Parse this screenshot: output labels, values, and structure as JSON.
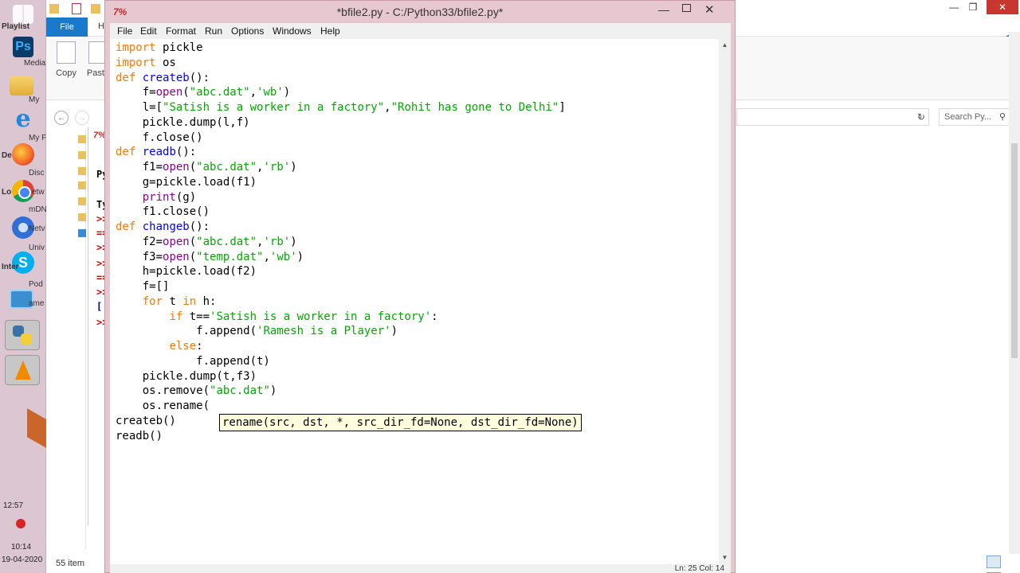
{
  "desktop": {
    "labels": [
      "Playlist",
      "Media",
      "My",
      "My F",
      "De",
      "Disc",
      "Lo",
      "etw",
      "mDN",
      "Netv",
      "Univ",
      "Inter",
      "Pod",
      "ame"
    ],
    "clock_a": "12:57",
    "clock_b": "10:14",
    "date": "19-04-2020"
  },
  "explorer": {
    "file_tab": "File",
    "home_tab": "H",
    "copy_label": "Copy",
    "paste_label": "Paste",
    "search_placeholder": "Search Py...",
    "status_items": "55 item",
    "shell_prompts": [
      "Py",
      "Ty",
      ">>",
      "==",
      ">>",
      ">>",
      "==",
      ">>",
      "[",
      ">>"
    ]
  },
  "editor": {
    "title": "*bfile2.py - C:/Python33/bfile2.py*",
    "logo": "7%",
    "menu": [
      "File",
      "Edit",
      "Format",
      "Run",
      "Options",
      "Windows",
      "Help"
    ],
    "code_lines": [
      [
        [
          "kw",
          "import"
        ],
        [
          "n",
          " pickle"
        ]
      ],
      [
        [
          "kw",
          "import"
        ],
        [
          "n",
          " os"
        ]
      ],
      [
        [
          "kw",
          "def"
        ],
        [
          "n",
          " "
        ],
        [
          "fn",
          "createb"
        ],
        [
          "n",
          "():"
        ]
      ],
      [
        [
          "n",
          "    f="
        ],
        [
          "bi",
          "open"
        ],
        [
          "n",
          "("
        ],
        [
          "st",
          "\"abc.dat\""
        ],
        [
          "n",
          ","
        ],
        [
          "st",
          "'wb'"
        ],
        [
          "n",
          ")"
        ]
      ],
      [
        [
          "n",
          "    l=["
        ],
        [
          "st",
          "\"Satish is a worker in a factory\""
        ],
        [
          "n",
          ","
        ],
        [
          "st",
          "\"Rohit has gone to Delhi\""
        ],
        [
          "n",
          "]"
        ]
      ],
      [
        [
          "n",
          "    pickle.dump(l,f)"
        ]
      ],
      [
        [
          "n",
          "    f.close()"
        ]
      ],
      [
        [
          "kw",
          "def"
        ],
        [
          "n",
          " "
        ],
        [
          "fn",
          "readb"
        ],
        [
          "n",
          "():"
        ]
      ],
      [
        [
          "n",
          "    f1="
        ],
        [
          "bi",
          "open"
        ],
        [
          "n",
          "("
        ],
        [
          "st",
          "\"abc.dat\""
        ],
        [
          "n",
          ","
        ],
        [
          "st",
          "'rb'"
        ],
        [
          "n",
          ")"
        ]
      ],
      [
        [
          "n",
          "    g=pickle.load(f1)"
        ]
      ],
      [
        [
          "n",
          "    "
        ],
        [
          "bi",
          "print"
        ],
        [
          "n",
          "(g)"
        ]
      ],
      [
        [
          "n",
          "    f1.close()"
        ]
      ],
      [
        [
          "kw",
          "def"
        ],
        [
          "n",
          " "
        ],
        [
          "fn",
          "changeb"
        ],
        [
          "n",
          "():"
        ]
      ],
      [
        [
          "n",
          "    f2="
        ],
        [
          "bi",
          "open"
        ],
        [
          "n",
          "("
        ],
        [
          "st",
          "\"abc.dat\""
        ],
        [
          "n",
          ","
        ],
        [
          "st",
          "'rb'"
        ],
        [
          "n",
          ")"
        ]
      ],
      [
        [
          "n",
          "    f3="
        ],
        [
          "bi",
          "open"
        ],
        [
          "n",
          "("
        ],
        [
          "st",
          "\"temp.dat\""
        ],
        [
          "n",
          ","
        ],
        [
          "st",
          "'wb'"
        ],
        [
          "n",
          ")"
        ]
      ],
      [
        [
          "n",
          "    h=pickle.load(f2)"
        ]
      ],
      [
        [
          "n",
          "    f=[]"
        ]
      ],
      [
        [
          "n",
          "    "
        ],
        [
          "kw",
          "for"
        ],
        [
          "n",
          " t "
        ],
        [
          "kw",
          "in"
        ],
        [
          "n",
          " h:"
        ]
      ],
      [
        [
          "n",
          "        "
        ],
        [
          "kw",
          "if"
        ],
        [
          "n",
          " t=="
        ],
        [
          "st",
          "'Satish is a worker in a factory'"
        ],
        [
          "n",
          ":"
        ]
      ],
      [
        [
          "n",
          "            f.append("
        ],
        [
          "st",
          "'Ramesh is a Player'"
        ],
        [
          "n",
          ")"
        ]
      ],
      [
        [
          "n",
          "        "
        ],
        [
          "kw",
          "else"
        ],
        [
          "n",
          ":"
        ]
      ],
      [
        [
          "n",
          "            f.append(t)"
        ]
      ],
      [
        [
          "n",
          "    pickle.dump(t,f3)"
        ]
      ],
      [
        [
          "n",
          "    os.remove("
        ],
        [
          "st",
          "\"abc.dat\""
        ],
        [
          "n",
          ")"
        ]
      ],
      [
        [
          "n",
          "    os.rename("
        ]
      ],
      [
        [
          "n",
          "createb()"
        ]
      ],
      [
        [
          "n",
          "readb()"
        ]
      ]
    ],
    "calltip": "rename(src, dst, *, src_dir_fd=None, dst_dir_fd=None)",
    "status": "Ln: 25 Col: 14"
  }
}
